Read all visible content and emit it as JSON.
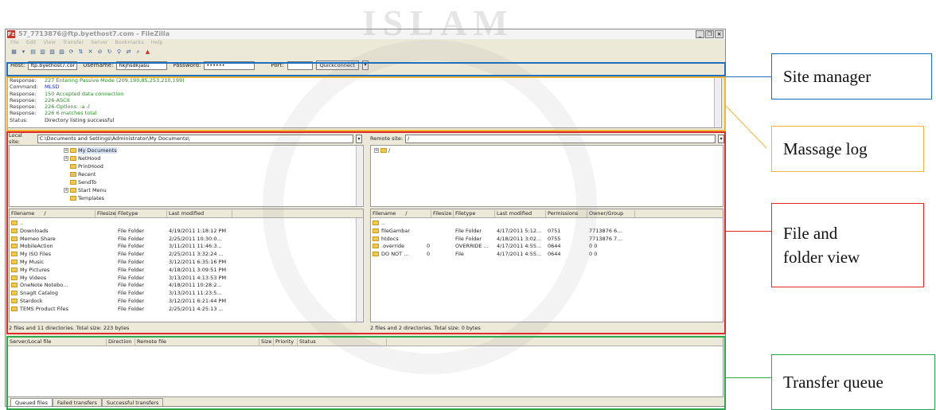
{
  "window": {
    "title": "57_7713876@ftp.byethost7.com - FileZilla",
    "app_icon": "filezilla-icon",
    "controls": [
      "_",
      "❐",
      "×"
    ],
    "menu": [
      "File",
      "Edit",
      "View",
      "Transfer",
      "Server",
      "Bookmarks",
      "Help"
    ]
  },
  "quickconnect": {
    "host_label": "Host:",
    "host_value": "ftp.byethost7.com",
    "username_label": "Username:",
    "username_value": "hkjhsdkjasu",
    "password_label": "Password:",
    "password_value": "••••••",
    "port_label": "Port:",
    "port_value": "",
    "button": "Quickconnect",
    "dropdown": "▾"
  },
  "message_log": [
    {
      "label": "Response:",
      "text": "227 Entering Passive Mode (209,190,85,253,210,199)",
      "kind": "resp"
    },
    {
      "label": "Command:",
      "text": "MLSD",
      "kind": "cmd"
    },
    {
      "label": "Response:",
      "text": "150 Accepted data connection",
      "kind": "resp"
    },
    {
      "label": "Response:",
      "text": "226-ASCII",
      "kind": "resp"
    },
    {
      "label": "Response:",
      "text": "226-Options: -a -l",
      "kind": "resp"
    },
    {
      "label": "Response:",
      "text": "226 6 matches total",
      "kind": "resp"
    },
    {
      "label": "Status:",
      "text": "Directory listing successful",
      "kind": "stat"
    }
  ],
  "local": {
    "site_label": "Local site:",
    "site_value": "C:\\Documents and Settings\\Administrator\\My Documents\\",
    "tree": [
      "My Documents",
      "NetHood",
      "PrintHood",
      "Recent",
      "SendTo",
      "Start Menu",
      "Templates"
    ],
    "columns": [
      "Filename",
      "/",
      "Filesize",
      "Filetype",
      "Last modified"
    ],
    "rows": [
      {
        "name": "..",
        "type": "",
        "modified": ""
      },
      {
        "name": "Downloads",
        "type": "File Folder",
        "modified": "4/19/2011 1:18:12 PM"
      },
      {
        "name": "Memeo Share",
        "type": "File Folder",
        "modified": "2/25/2011 10:30:0..."
      },
      {
        "name": "MobileAction",
        "type": "File Folder",
        "modified": "3/11/2011 11:46:3..."
      },
      {
        "name": "My ISO Files",
        "type": "File Folder",
        "modified": "2/25/2011 3:32:24 ..."
      },
      {
        "name": "My Music",
        "type": "File Folder",
        "modified": "3/12/2011 6:35:16 PM"
      },
      {
        "name": "My Pictures",
        "type": "File Folder",
        "modified": "4/18/2011 3:09:51 PM"
      },
      {
        "name": "My Videos",
        "type": "File Folder",
        "modified": "3/13/2011 4:13:53 PM"
      },
      {
        "name": "OneNote Notebo...",
        "type": "File Folder",
        "modified": "4/18/2011 10:28:2..."
      },
      {
        "name": "SnagIt Catalog",
        "type": "File Folder",
        "modified": "3/13/2011 11:23:5..."
      },
      {
        "name": "Stardock",
        "type": "File Folder",
        "modified": "3/12/2011 6:21:44 PM"
      },
      {
        "name": "TEMS Product Files",
        "type": "File Folder",
        "modified": "2/25/2011 4:25:13 ..."
      }
    ],
    "status": "2 files and 11 directories. Total size: 223 bytes"
  },
  "remote": {
    "site_label": "Remote site:",
    "site_value": "/",
    "tree_root": "/",
    "columns": [
      "Filename",
      "/",
      "Filesize",
      "Filetype",
      "Last modified",
      "Permissions",
      "Owner/Group"
    ],
    "rows": [
      {
        "name": "..",
        "size": "",
        "type": "",
        "modified": "",
        "perms": "",
        "owner": ""
      },
      {
        "name": "fileGambar",
        "size": "",
        "type": "File Folder",
        "modified": "4/17/2011 5:12...",
        "perms": "0751",
        "owner": "7713876 6..."
      },
      {
        "name": "htdocs",
        "size": "",
        "type": "File Folder",
        "modified": "4/18/2011 3:02...",
        "perms": "0755",
        "owner": "7713876 7..."
      },
      {
        "name": ".override",
        "size": "0",
        "type": "OVERRIDE ...",
        "modified": "4/17/2011 4:55...",
        "perms": "0644",
        "owner": "0 0"
      },
      {
        "name": "DO NOT ...",
        "size": "0",
        "type": "File",
        "modified": "4/17/2011 4:55...",
        "perms": "0644",
        "owner": "0 0"
      }
    ],
    "status": "2 files and 2 directories. Total size: 0 bytes"
  },
  "queue": {
    "columns": [
      "Server/Local file",
      "Direction",
      "Remote file",
      "Size",
      "Priority",
      "Status"
    ],
    "tabs": [
      "Queued files",
      "Failed transfers",
      "Successful transfers"
    ]
  },
  "annotations": {
    "site_manager": "Site manager",
    "message_log": "Massage log",
    "file_folder_line1": "File and",
    "file_folder_line2": "folder view",
    "transfer_queue": "Transfer queue"
  },
  "colors": {
    "site_manager": "#1f6fbf",
    "message_log": "#f0b63a",
    "file_folder": "#e02a2a",
    "transfer_queue": "#2aa84a"
  },
  "watermark": {
    "text": "ISLAM"
  }
}
